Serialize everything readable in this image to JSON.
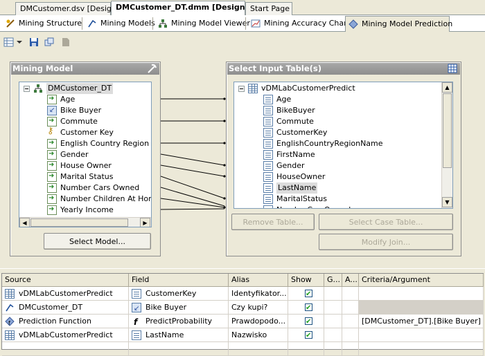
{
  "doc_tabs": [
    "DMCustomer.dsv [Design]",
    "DMCustomer_DT.dmm [Design]",
    "Start Page"
  ],
  "designer_tabs": [
    "Mining Structure",
    "Mining Models",
    "Mining Model Viewer",
    "Mining Accuracy Chart",
    "Mining Model Prediction"
  ],
  "mining_model_panel": {
    "title": "Mining Model",
    "root": "DMCustomer_DT",
    "columns": [
      {
        "label": "Age",
        "icon": "input-column-icon"
      },
      {
        "label": "Bike Buyer",
        "icon": "predict-column-icon"
      },
      {
        "label": "Commute",
        "icon": "input-column-icon"
      },
      {
        "label": "Customer Key",
        "icon": "key-column-icon"
      },
      {
        "label": "English Country Region Na",
        "icon": "input-column-icon"
      },
      {
        "label": "Gender",
        "icon": "input-column-icon"
      },
      {
        "label": "House Owner",
        "icon": "input-column-icon"
      },
      {
        "label": "Marital Status",
        "icon": "input-column-icon"
      },
      {
        "label": "Number Cars Owned",
        "icon": "input-column-icon"
      },
      {
        "label": "Number Children At Home",
        "icon": "input-column-icon"
      },
      {
        "label": "Yearly Income",
        "icon": "input-column-icon"
      }
    ],
    "select_model_button": "Select Model..."
  },
  "input_table_panel": {
    "title": "Select Input Table(s)",
    "table": "vDMLabCustomerPredict",
    "columns": [
      "Age",
      "BikeBuyer",
      "Commute",
      "CustomerKey",
      "EnglishCountryRegionName",
      "FirstName",
      "Gender",
      "HouseOwner",
      "LastName",
      "MaritalStatus",
      "NumberCarsOwned"
    ],
    "selected": "LastName",
    "remove_table_button": "Remove Table...",
    "select_case_table_button": "Select Case Table...",
    "modify_join_button": "Modify Join..."
  },
  "grid": {
    "headers": [
      "Source",
      "Field",
      "Alias",
      "Show",
      "G...",
      "A...",
      "Criteria/Argument"
    ],
    "rows": [
      {
        "source": "vDMLabCustomerPredict",
        "source_icon": "table-icon",
        "field": "CustomerKey",
        "field_icon": "column-icon",
        "alias": "Identyfikator...",
        "show": true,
        "criteria": ""
      },
      {
        "source": "DMCustomer_DT",
        "source_icon": "mining-model-icon",
        "field": "Bike Buyer",
        "field_icon": "predict-column-icon",
        "alias": "Czy kupi?",
        "show": true,
        "criteria": ""
      },
      {
        "source": "Prediction Function",
        "source_icon": "prediction-function-icon",
        "field": "PredictProbability",
        "field_icon": "function-icon",
        "alias": "Prawdopodo...",
        "show": true,
        "criteria": "[DMCustomer_DT].[Bike Buyer]"
      },
      {
        "source": "vDMLabCustomerPredict",
        "source_icon": "table-icon",
        "field": "LastName",
        "field_icon": "column-icon",
        "alias": "Nazwisko",
        "show": true,
        "criteria": ""
      }
    ]
  }
}
